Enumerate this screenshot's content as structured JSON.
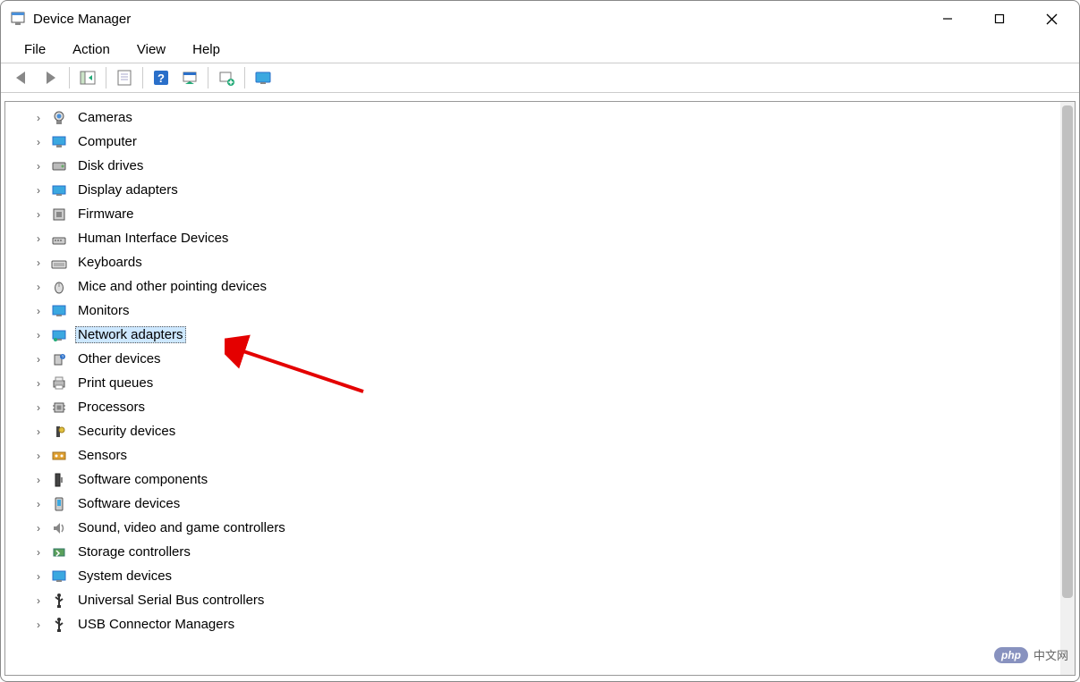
{
  "window": {
    "title": "Device Manager"
  },
  "menu": {
    "items": [
      "File",
      "Action",
      "View",
      "Help"
    ]
  },
  "toolbar": {
    "back": "back-icon",
    "forward": "forward-icon",
    "show_hide": "show-hide-tree-icon",
    "properties": "properties-icon",
    "help": "help-icon",
    "scan": "scan-hardware-icon",
    "add_legacy": "add-legacy-icon",
    "monitor": "monitor-icon"
  },
  "tree": {
    "items": [
      {
        "label": "Cameras",
        "icon": "camera-icon"
      },
      {
        "label": "Computer",
        "icon": "computer-icon"
      },
      {
        "label": "Disk drives",
        "icon": "disk-icon"
      },
      {
        "label": "Display adapters",
        "icon": "display-adapter-icon"
      },
      {
        "label": "Firmware",
        "icon": "firmware-icon"
      },
      {
        "label": "Human Interface Devices",
        "icon": "hid-icon"
      },
      {
        "label": "Keyboards",
        "icon": "keyboard-icon"
      },
      {
        "label": "Mice and other pointing devices",
        "icon": "mouse-icon"
      },
      {
        "label": "Monitors",
        "icon": "monitor-device-icon"
      },
      {
        "label": "Network adapters",
        "icon": "network-adapter-icon",
        "selected": true
      },
      {
        "label": "Other devices",
        "icon": "other-device-icon"
      },
      {
        "label": "Print queues",
        "icon": "printer-icon"
      },
      {
        "label": "Processors",
        "icon": "processor-icon"
      },
      {
        "label": "Security devices",
        "icon": "security-icon"
      },
      {
        "label": "Sensors",
        "icon": "sensor-icon"
      },
      {
        "label": "Software components",
        "icon": "software-component-icon"
      },
      {
        "label": "Software devices",
        "icon": "software-device-icon"
      },
      {
        "label": "Sound, video and game controllers",
        "icon": "sound-icon"
      },
      {
        "label": "Storage controllers",
        "icon": "storage-icon"
      },
      {
        "label": "System devices",
        "icon": "system-device-icon"
      },
      {
        "label": "Universal Serial Bus controllers",
        "icon": "usb-icon"
      },
      {
        "label": "USB Connector Managers",
        "icon": "usb-connector-icon"
      }
    ]
  },
  "watermark": {
    "badge": "php",
    "text": "中文网"
  }
}
